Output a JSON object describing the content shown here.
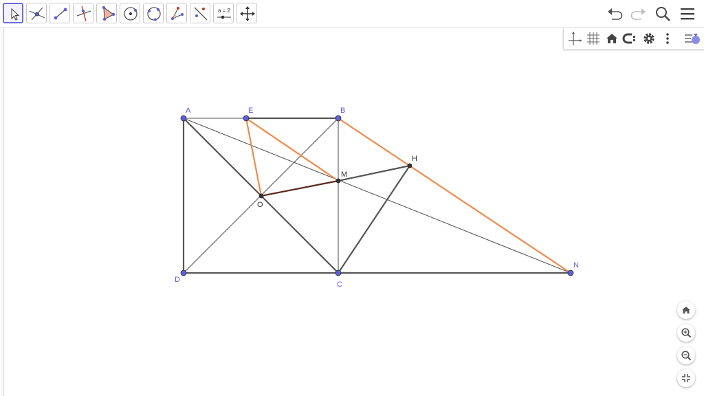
{
  "toolbar": {
    "tools": [
      {
        "name": "move"
      },
      {
        "name": "point"
      },
      {
        "name": "segment"
      },
      {
        "name": "perpendicular-line"
      },
      {
        "name": "polygon"
      },
      {
        "name": "circle-center-point"
      },
      {
        "name": "circle-through-points"
      },
      {
        "name": "angle"
      },
      {
        "name": "reflect-about-line"
      },
      {
        "name": "slider",
        "label": "a = 2"
      },
      {
        "name": "move-graphics-view"
      }
    ],
    "selected_tool": "move",
    "right_icons": [
      "undo-icon",
      "redo-icon",
      "search-icon",
      "menu-icon"
    ]
  },
  "graphics_toolbar": {
    "icons": [
      "axes-icon",
      "grid-icon",
      "home-icon",
      "point-capturing-icon",
      "settings-icon",
      "more-icon",
      "style-bar-toggle-icon"
    ]
  },
  "zoom_controls": [
    "home-icon",
    "zoom-in-icon",
    "zoom-out-icon",
    "exit-fullscreen-icon"
  ],
  "colors": {
    "free_point": "#5e5edc",
    "dependent_point": "#333333",
    "label_free": "#5e5edc",
    "label_dependent": "#333333",
    "segment_dark": "#555555",
    "segment_orange": "#f08a4b",
    "segment_brown": "#5a2a1a"
  },
  "figure": {
    "points": {
      "A": {
        "label": "A",
        "free": true
      },
      "B": {
        "label": "B",
        "free": true
      },
      "C": {
        "label": "C",
        "free": true
      },
      "D": {
        "label": "D",
        "free": true
      },
      "E": {
        "label": "E",
        "free": true
      },
      "N": {
        "label": "N",
        "free": true
      },
      "M": {
        "label": "M",
        "free": false
      },
      "O": {
        "label": "O",
        "free": false
      },
      "H": {
        "label": "H",
        "free": false
      }
    },
    "segments": [
      {
        "from": "A",
        "to": "B",
        "color": "dark",
        "weight": "thin"
      },
      {
        "from": "E",
        "to": "B",
        "color": "dark",
        "weight": "thick"
      },
      {
        "from": "A",
        "to": "D",
        "color": "dark",
        "weight": "thick"
      },
      {
        "from": "D",
        "to": "N",
        "color": "dark",
        "weight": "thick"
      },
      {
        "from": "B",
        "to": "C",
        "color": "dark",
        "weight": "thin"
      },
      {
        "from": "A",
        "to": "C",
        "color": "dark",
        "weight": "thick"
      },
      {
        "from": "D",
        "to": "B",
        "color": "dark",
        "weight": "thin"
      },
      {
        "from": "A",
        "to": "N",
        "color": "dark",
        "weight": "thin"
      },
      {
        "from": "M",
        "to": "H",
        "color": "dark",
        "weight": "thick"
      },
      {
        "from": "C",
        "to": "H",
        "color": "dark",
        "weight": "thick"
      },
      {
        "from": "E",
        "to": "O",
        "color": "orange",
        "weight": "thick"
      },
      {
        "from": "E",
        "to": "M",
        "color": "orange",
        "weight": "thick"
      },
      {
        "from": "B",
        "to": "N",
        "color": "orange",
        "weight": "thick"
      },
      {
        "from": "O",
        "to": "M",
        "color": "brown",
        "weight": "thick"
      }
    ]
  }
}
